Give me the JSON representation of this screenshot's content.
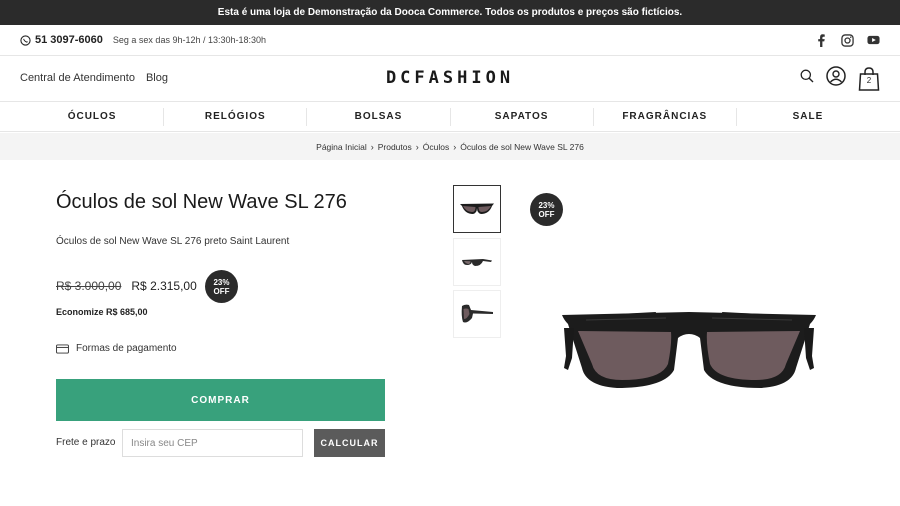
{
  "announcement": "Esta é uma loja de Demonstração da Dooca Commerce. Todos os produtos e preços são fictícios.",
  "contact": {
    "phone": "51 3097-6060",
    "hours": "Seg a sex das 9h-12h / 13:30h-18:30h"
  },
  "social": [
    {
      "icon": "facebook-icon"
    },
    {
      "icon": "instagram-icon"
    },
    {
      "icon": "youtube-icon"
    }
  ],
  "header": {
    "links": [
      "Central de Atendimento",
      "Blog"
    ],
    "logo": "DCFASHION",
    "cart_count": "2"
  },
  "nav": [
    "ÓCULOS",
    "RELÓGIOS",
    "BOLSAS",
    "SAPATOS",
    "FRAGRÂNCIAS",
    "SALE"
  ],
  "breadcrumb": [
    "Página Inicial",
    "Produtos",
    "Óculos",
    "Óculos de sol New Wave SL 276"
  ],
  "product": {
    "title": "Óculos de sol New Wave SL 276",
    "subtitle": "Óculos de sol New Wave SL 276 preto Saint Laurent",
    "old_price": "R$ 3.000,00",
    "price": "R$ 2.315,00",
    "discount_pct": "23%",
    "discount_label": "OFF",
    "savings": "Economize R$ 685,00",
    "payment_label": "Formas de pagamento",
    "buy_label": "COMPRAR",
    "shipping_label": "Frete e prazo",
    "cep_placeholder": "Insira seu CEP",
    "calc_label": "CALCULAR",
    "thumbnails": [
      "sunglasses-front-thumb",
      "sunglasses-angle-thumb",
      "sunglasses-side-thumb"
    ]
  },
  "colors": {
    "accent": "#38a17c",
    "dark": "#2b2b2b",
    "lens": "#6e5b5e"
  }
}
